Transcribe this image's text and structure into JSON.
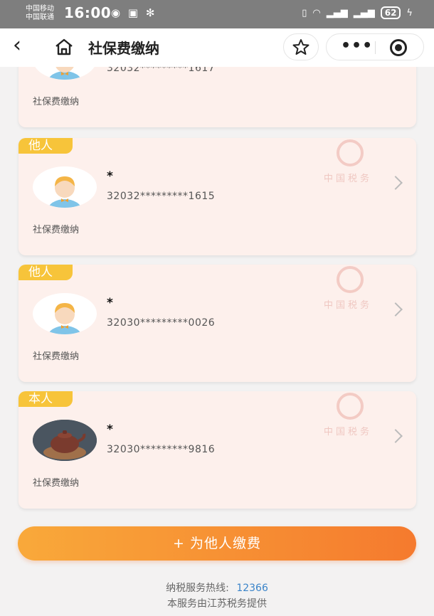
{
  "status_bar": {
    "carrier1": "中国移动",
    "carrier2": "中国联通",
    "time": "16:00",
    "battery": "62"
  },
  "navbar": {
    "title": "社保费缴纳"
  },
  "cards": [
    {
      "tag": "",
      "name": "",
      "id": "32032*********1617",
      "type": "社保费缴纳",
      "avatar": "cartoon"
    },
    {
      "tag": "他人",
      "name": "*",
      "id": "32032*********1615",
      "type": "社保费缴纳",
      "avatar": "cartoon"
    },
    {
      "tag": "他人",
      "name": "*",
      "id": "32030*********0026",
      "type": "社保费缴纳",
      "avatar": "cartoon"
    },
    {
      "tag": "本人",
      "name": "*",
      "id": "32030*********9816",
      "type": "社保费缴纳",
      "avatar": "photo"
    }
  ],
  "emblem_text": "中国税务",
  "actions": {
    "pay_for_others": "+ 为他人缴费"
  },
  "footer": {
    "hotline_label": "纳税服务热线:",
    "hotline_number": "12366",
    "provider": "本服务由江苏税务提供"
  },
  "colors": {
    "accent_start": "#f9a93a",
    "accent_end": "#f57a2e",
    "tag": "#f7c43a",
    "card_bg": "#fdf0ec",
    "link": "#3a84c9"
  }
}
